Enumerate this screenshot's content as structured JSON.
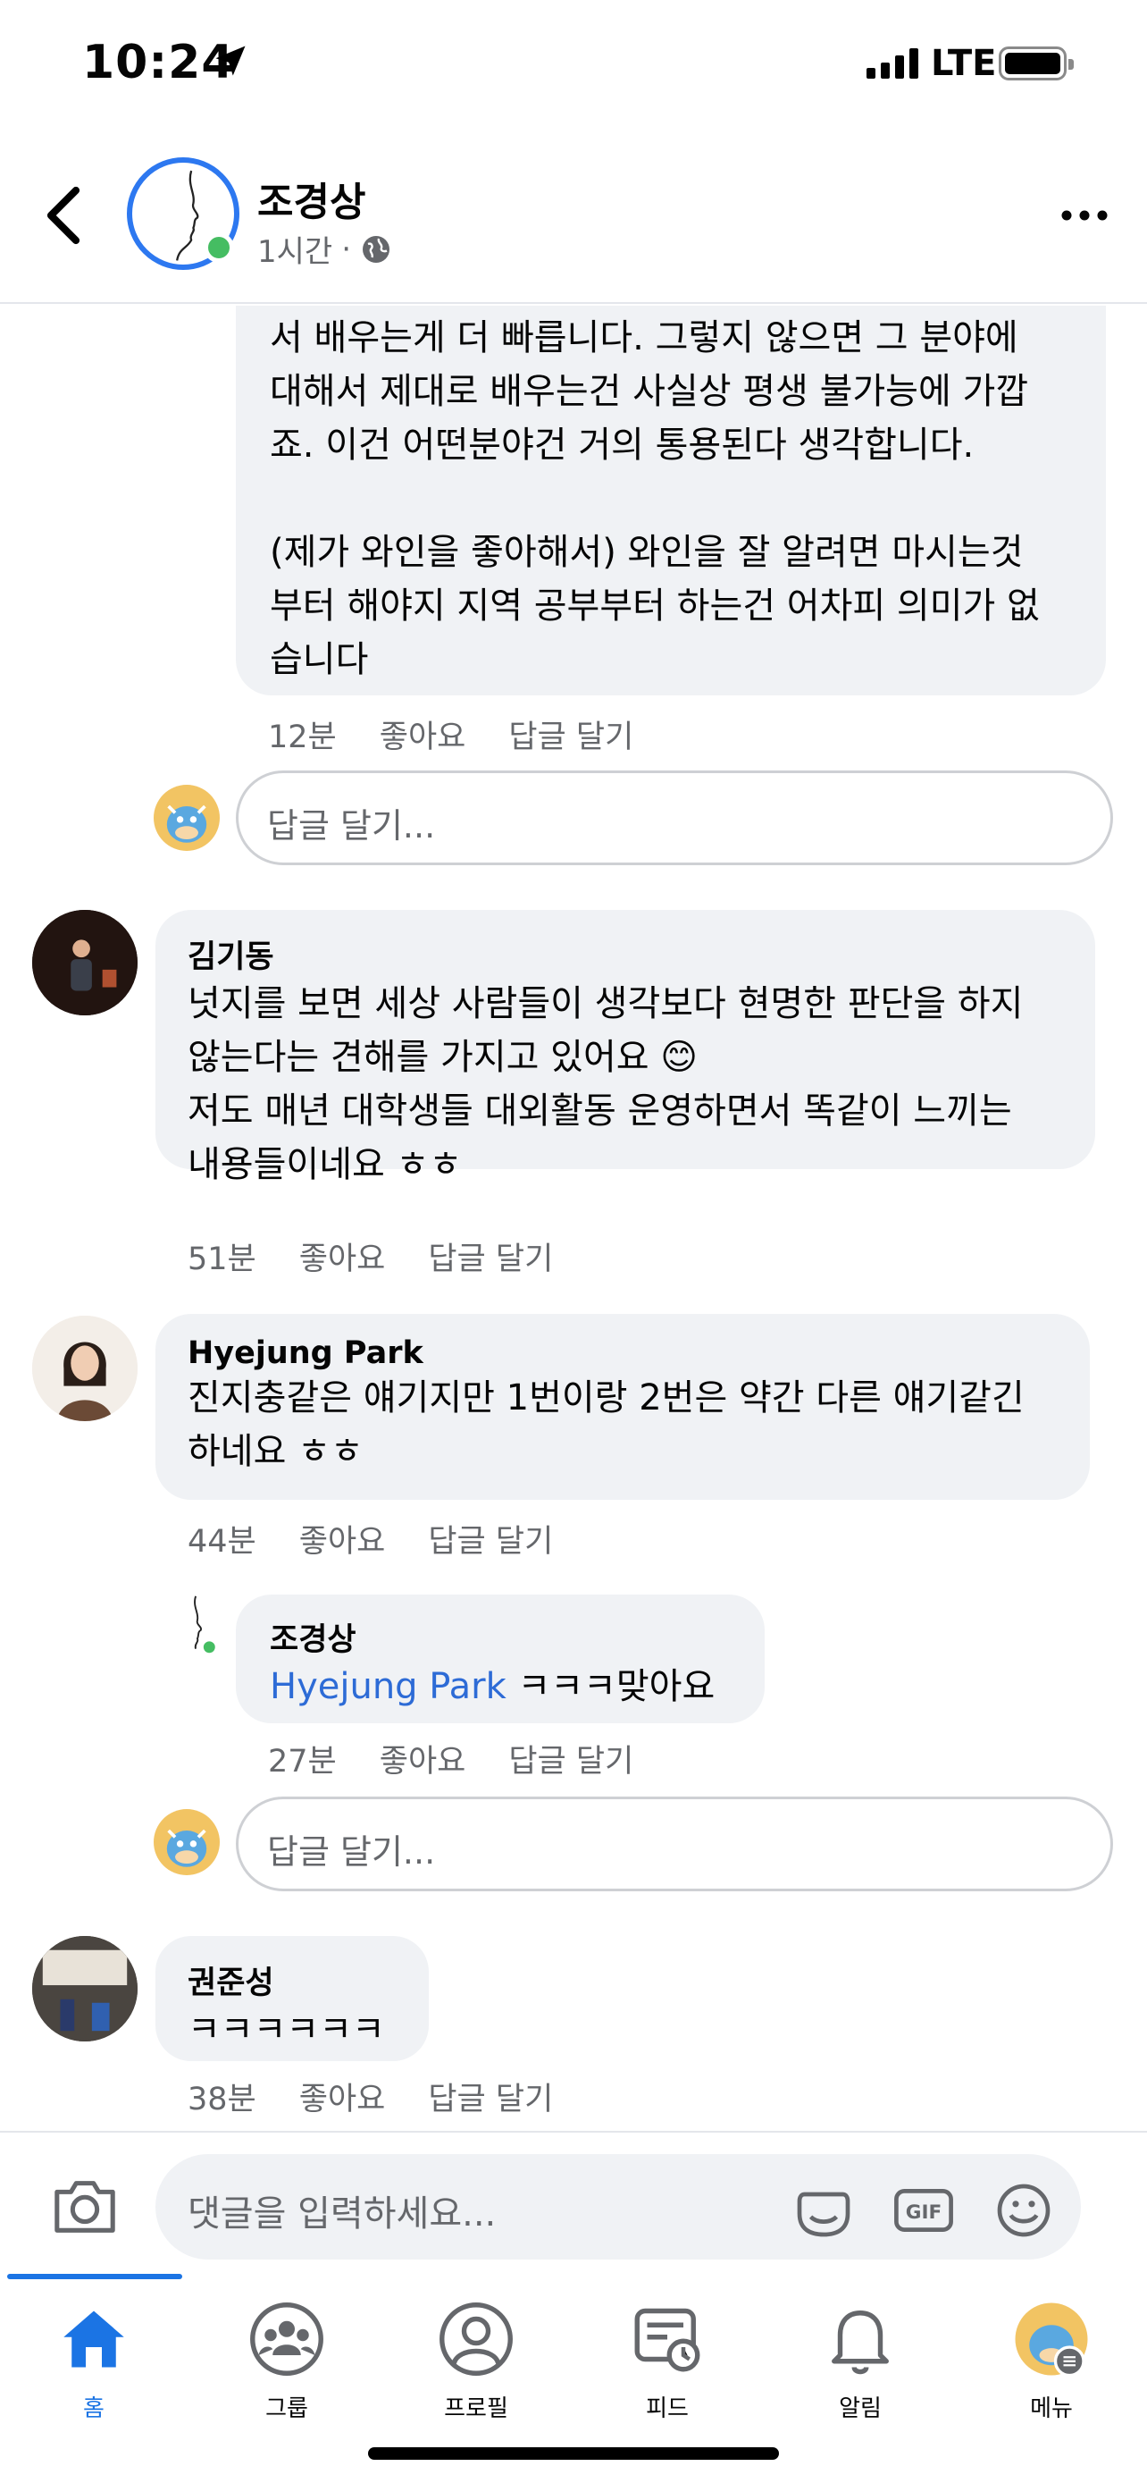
{
  "status_bar": {
    "time": "10:24",
    "network": "LTE"
  },
  "header": {
    "name": "조경상",
    "time": "1시간",
    "separator": "·"
  },
  "comments": {
    "first_reply": {
      "text": "서 배우는게 더 빠릅니다. 그렇지 않으면 그 분야에\n대해서 제대로 배우는건 사실상 평생 불가능에 가깝\n죠. 이건 어떤분야건 거의 통용된다 생각합니다.\n\n(제가 와인을 좋아해서) 와인을 잘 알려면 마시는것\n부터 해야지 지역 공부부터 하는건 어차피 의미가 없\n습니다",
      "time": "12분",
      "like": "좋아요",
      "reply": "답글 달기"
    },
    "reply_box_1": {
      "placeholder": "답글 달기..."
    },
    "kim": {
      "author": "김기동",
      "text1": "넛지를 보면 세상 사람들이 생각보다 현명한 판단을 하지\n않는다는 견해를 가지고 있어요",
      "emoji": "😊",
      "text2": "저도 매년 대학생들 대외활동 운영하면서 똑같이 느끼는\n내용들이네요 ㅎㅎ",
      "time": "51분",
      "like": "좋아요",
      "reply": "답글 달기"
    },
    "park": {
      "author": "Hyejung Park",
      "text": "진지충같은 얘기지만 1번이랑 2번은 약간 다른 얘기같긴\n하네요 ㅎㅎ",
      "time": "44분",
      "like": "좋아요",
      "reply": "답글 달기"
    },
    "cho_reply": {
      "author": "조경상",
      "mention": "Hyejung Park",
      "text": " ㅋㅋㅋ맞아요",
      "time": "27분",
      "like": "좋아요",
      "reply": "답글 달기"
    },
    "reply_box_2": {
      "placeholder": "답글 달기..."
    },
    "kwon": {
      "author": "권준성",
      "text": "ㅋㅋㅋㅋㅋㅋ",
      "time": "38분",
      "like": "좋아요",
      "reply": "답글 달기"
    }
  },
  "composer": {
    "placeholder": "댓글을 입력하세요...",
    "gif": "GIF"
  },
  "tabs": [
    {
      "label": "홈",
      "icon": "home-icon",
      "active": true
    },
    {
      "label": "그룹",
      "icon": "groups-icon"
    },
    {
      "label": "프로필",
      "icon": "profile-icon"
    },
    {
      "label": "피드",
      "icon": "feed-icon"
    },
    {
      "label": "알림",
      "icon": "bell-icon"
    },
    {
      "label": "메뉴",
      "icon": "menu-avatar-icon"
    }
  ],
  "colors": {
    "accent": "#1b74e4",
    "online": "#45bd62",
    "bubble": "#f0f2f5",
    "mention": "#2d6bd6"
  }
}
